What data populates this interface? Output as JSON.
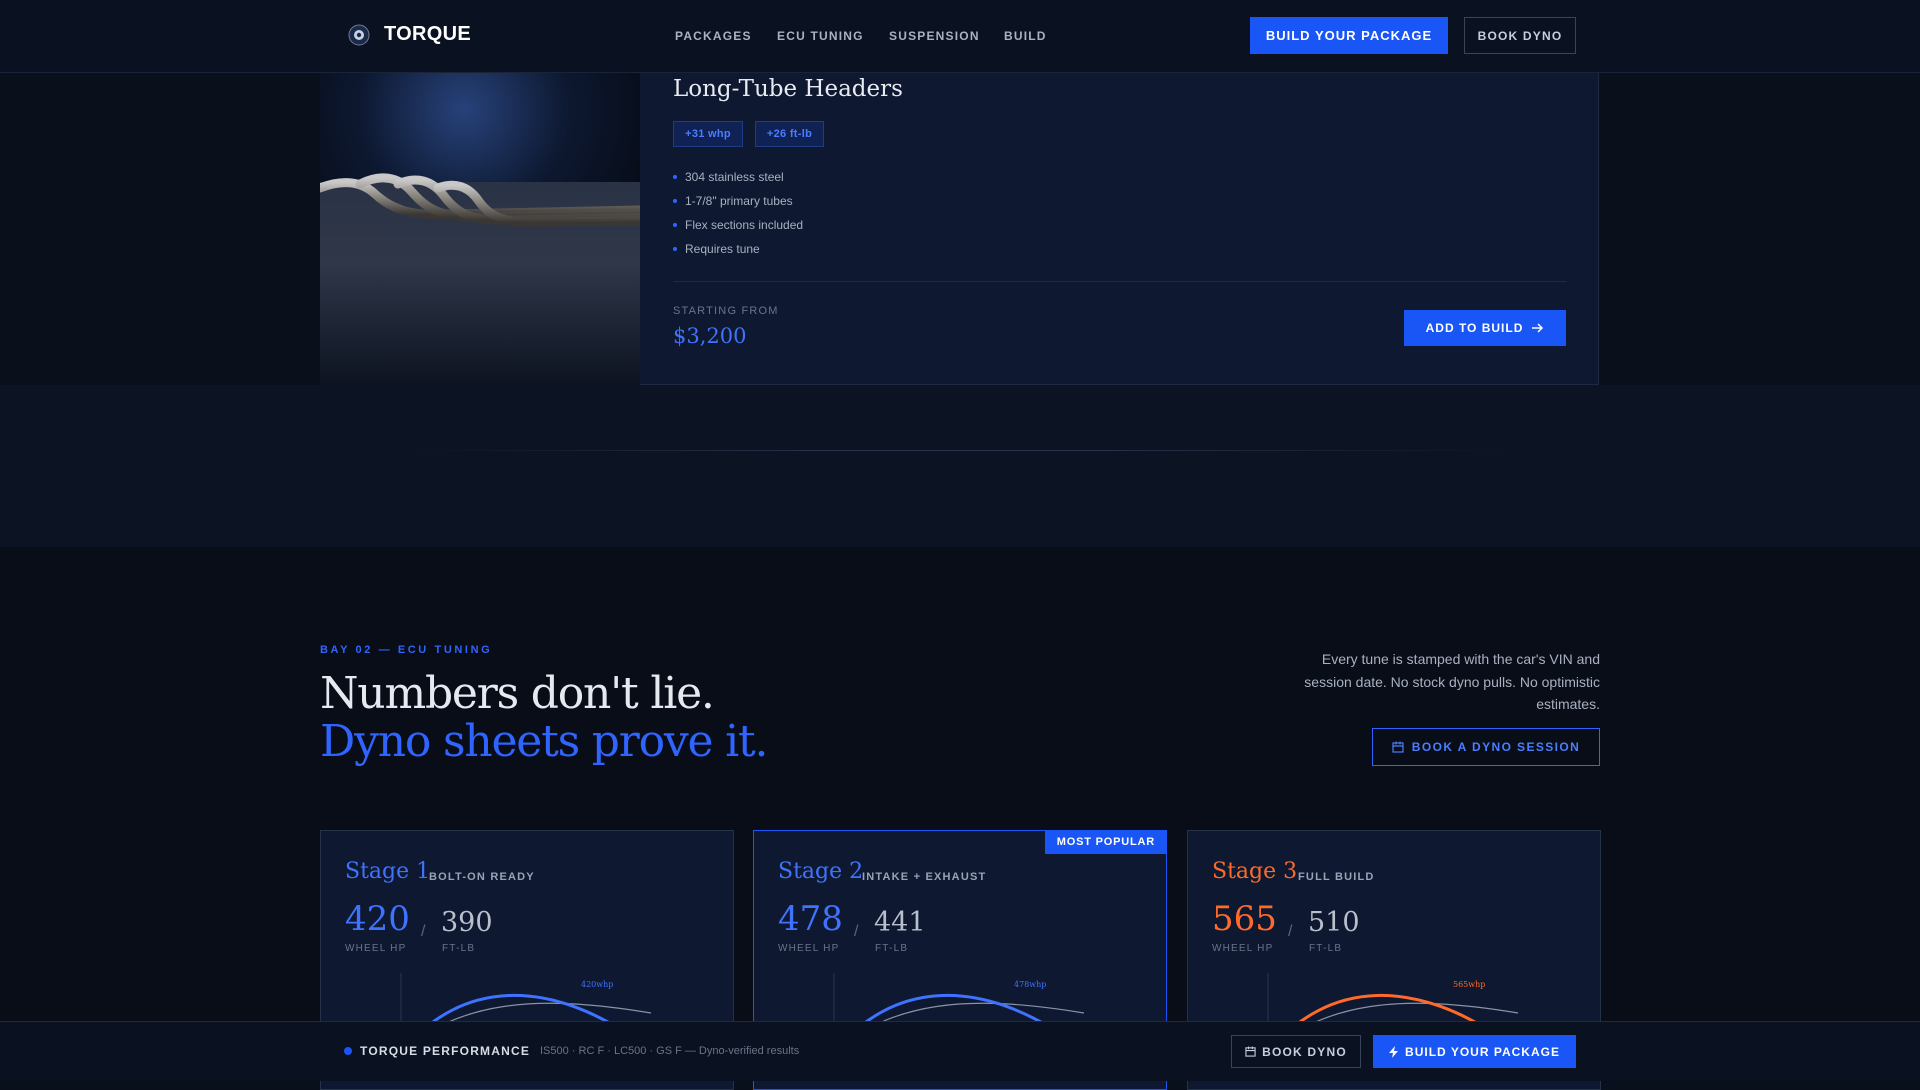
{
  "brand": {
    "name": "TORQUE"
  },
  "nav": {
    "links": [
      "PACKAGES",
      "ECU TUNING",
      "SUSPENSION",
      "BUILD"
    ],
    "cta_primary": "BUILD YOUR PACKAGE",
    "cta_secondary": "BOOK DYNO"
  },
  "product": {
    "title": "Long-Tube Headers",
    "tags": [
      "+31 whp",
      "+26 ft-lb"
    ],
    "features": [
      "304 stainless steel",
      "1-7/8\" primary tubes",
      "Flex sections included",
      "Requires tune"
    ],
    "price_label": "STARTING FROM",
    "price": "$3,200",
    "add_button": "ADD TO BUILD"
  },
  "ecu": {
    "eyebrow": "BAY 02 — ECU TUNING",
    "headline_1": "Numbers don't lie.",
    "headline_2": "Dyno sheets prove it.",
    "intro": "Every tune is stamped with the car's VIN and session date. No stock dyno pulls. No optimistic estimates.",
    "book_button": "BOOK A DYNO SESSION",
    "stages": [
      {
        "name": "Stage 1",
        "subtitle": "BOLT-ON READY",
        "whp": "420",
        "ftlb": "390",
        "whp_unit": "WHEEL HP",
        "ftlb_unit": "FT-LB",
        "curve_label": "420whp",
        "accent": "#3f73ff"
      },
      {
        "name": "Stage 2",
        "subtitle": "INTAKE + EXHAUST",
        "whp": "478",
        "ftlb": "441",
        "whp_unit": "WHEEL HP",
        "ftlb_unit": "FT-LB",
        "curve_label": "478whp",
        "accent": "#3f73ff",
        "badge": "MOST POPULAR"
      },
      {
        "name": "Stage 3",
        "subtitle": "FULL BUILD",
        "whp": "565",
        "ftlb": "510",
        "whp_unit": "WHEEL HP",
        "ftlb_unit": "FT-LB",
        "curve_label": "565whp",
        "accent": "#ff6a2a"
      }
    ]
  },
  "footer_bar": {
    "brand": "TORQUE PERFORMANCE",
    "meta": "IS500 · RC F · LC500 · GS F — Dyno-verified results",
    "book": "BOOK DYNO",
    "build": "BUILD YOUR PACKAGE"
  },
  "colors": {
    "accent": "#1a55f5",
    "accent_text": "#3f73ff",
    "stage3": "#ff6a2a",
    "bg": "#0a0f1c"
  }
}
